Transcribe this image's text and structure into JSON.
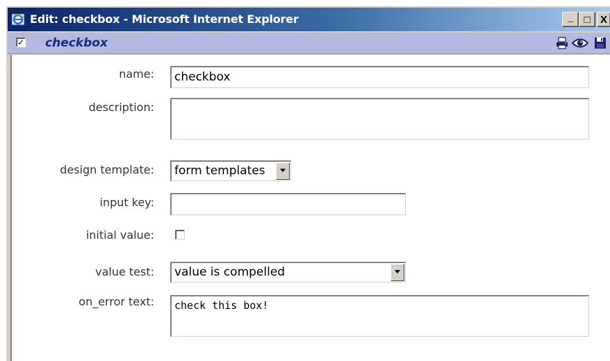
{
  "window": {
    "title": "Edit: checkbox - Microsoft Internet Explorer",
    "controls": {
      "minimize": "_",
      "maximize": "□",
      "close": "X"
    }
  },
  "header": {
    "checkbox_glyph": "✓",
    "title": "checkbox",
    "icons": [
      "print-icon",
      "view-icon",
      "save-icon"
    ]
  },
  "form": {
    "name": {
      "label": "name:",
      "value": "checkbox"
    },
    "description": {
      "label": "description:",
      "value": ""
    },
    "design_template": {
      "label": "design template:",
      "value": "form templates"
    },
    "input_key": {
      "label": "input key:",
      "value": ""
    },
    "initial_value": {
      "label": "initial value:",
      "checked": false
    },
    "value_test": {
      "label": "value test:",
      "value": "value is compelled"
    },
    "on_error_text": {
      "label": "on_error text:",
      "value": "check this box!"
    }
  },
  "colors": {
    "titlebar_start": "#0a246a",
    "titlebar_end": "#a6caf0",
    "header_bar": "#b3b9df",
    "header_title": "#1c2a7a"
  }
}
